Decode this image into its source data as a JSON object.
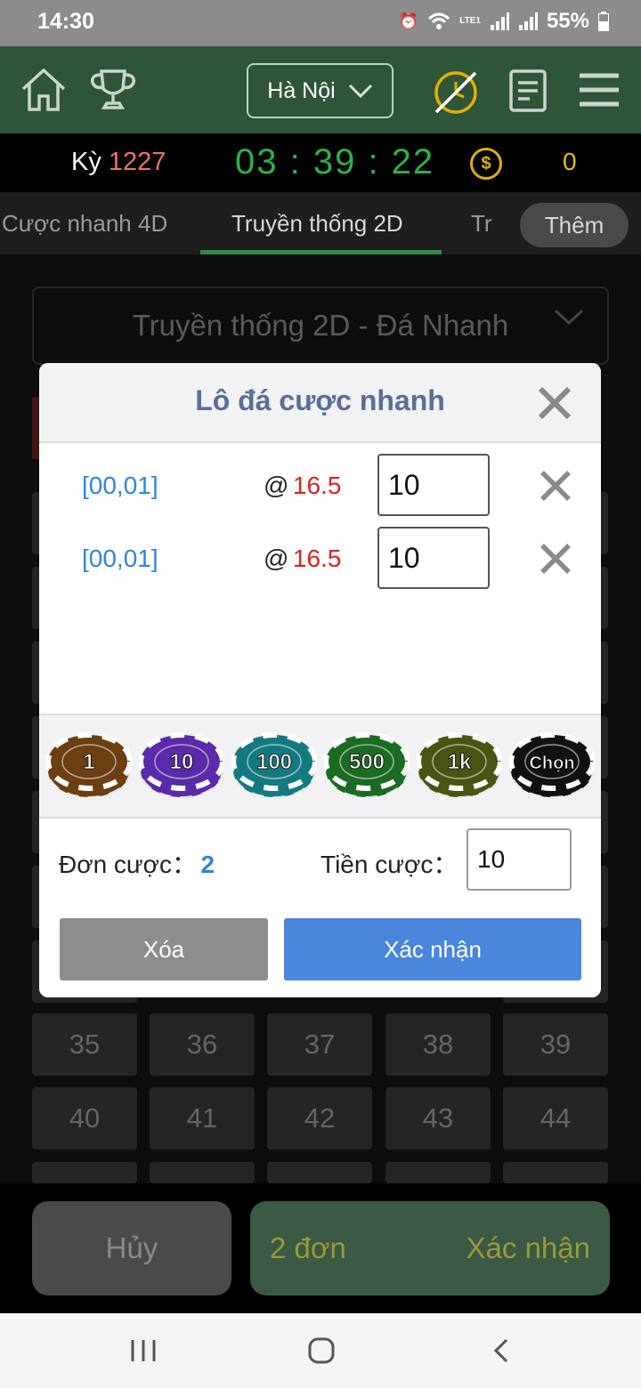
{
  "status_bar": {
    "time": "14:30",
    "network": "LTE1",
    "battery": "55%",
    "icons": [
      "alarm-icon",
      "wifi-icon",
      "signal-icon",
      "signal-icon",
      "battery-icon"
    ]
  },
  "header": {
    "icons": [
      "home-icon",
      "trophy-icon",
      "disabled-clock-icon",
      "document-icon",
      "menu-icon"
    ],
    "city": "Hà Nội"
  },
  "period": {
    "label": "Kỳ",
    "number": "1227",
    "countdown": "03 : 39 : 22",
    "balance": "0",
    "currency_symbol": "$"
  },
  "tabs": [
    {
      "label": "Cược nhanh 4D",
      "active": false
    },
    {
      "label": "Truyền thống 2D",
      "active": true
    },
    {
      "label": "Tr",
      "active": false
    }
  ],
  "more_button": "Thêm",
  "game_selector": "Truyền thống 2D - Đá Nhanh",
  "grid": [
    [
      "35",
      "36",
      "37",
      "38",
      "39"
    ],
    [
      "40",
      "41",
      "42",
      "43",
      "44"
    ]
  ],
  "modal": {
    "title": "Lô đá cược nhanh",
    "bets": [
      {
        "numbers": "[00,01]",
        "at": "@",
        "odds": "16.5",
        "amount": "10"
      },
      {
        "numbers": "[00,01]",
        "at": "@",
        "odds": "16.5",
        "amount": "10"
      }
    ],
    "chips": [
      {
        "label": "1",
        "color": "#6b3f12"
      },
      {
        "label": "10",
        "color": "#5a2aa8"
      },
      {
        "label": "100",
        "color": "#157a80"
      },
      {
        "label": "500",
        "color": "#1b6b22"
      },
      {
        "label": "1k",
        "color": "#4b5312"
      },
      {
        "label": "Chọn",
        "color": "#111111"
      }
    ],
    "order_count_label": "Đơn cược：",
    "order_count": "2",
    "bet_amount_label": "Tiền cược：",
    "bet_amount": "10",
    "delete_button": "Xóa",
    "confirm_button": "Xác nhận"
  },
  "bottom": {
    "cancel": "Hủy",
    "count": "2 đơn",
    "confirm": "Xác nhận"
  },
  "nav": {
    "icons": [
      "recents-icon",
      "home-circle-icon",
      "back-icon"
    ]
  },
  "colors": {
    "header_green": "#2f5539",
    "tab_underline": "#2c8a4a",
    "accent_blue": "#4a86dc",
    "odds_red": "#e02020",
    "timer_green": "#27b34a"
  }
}
